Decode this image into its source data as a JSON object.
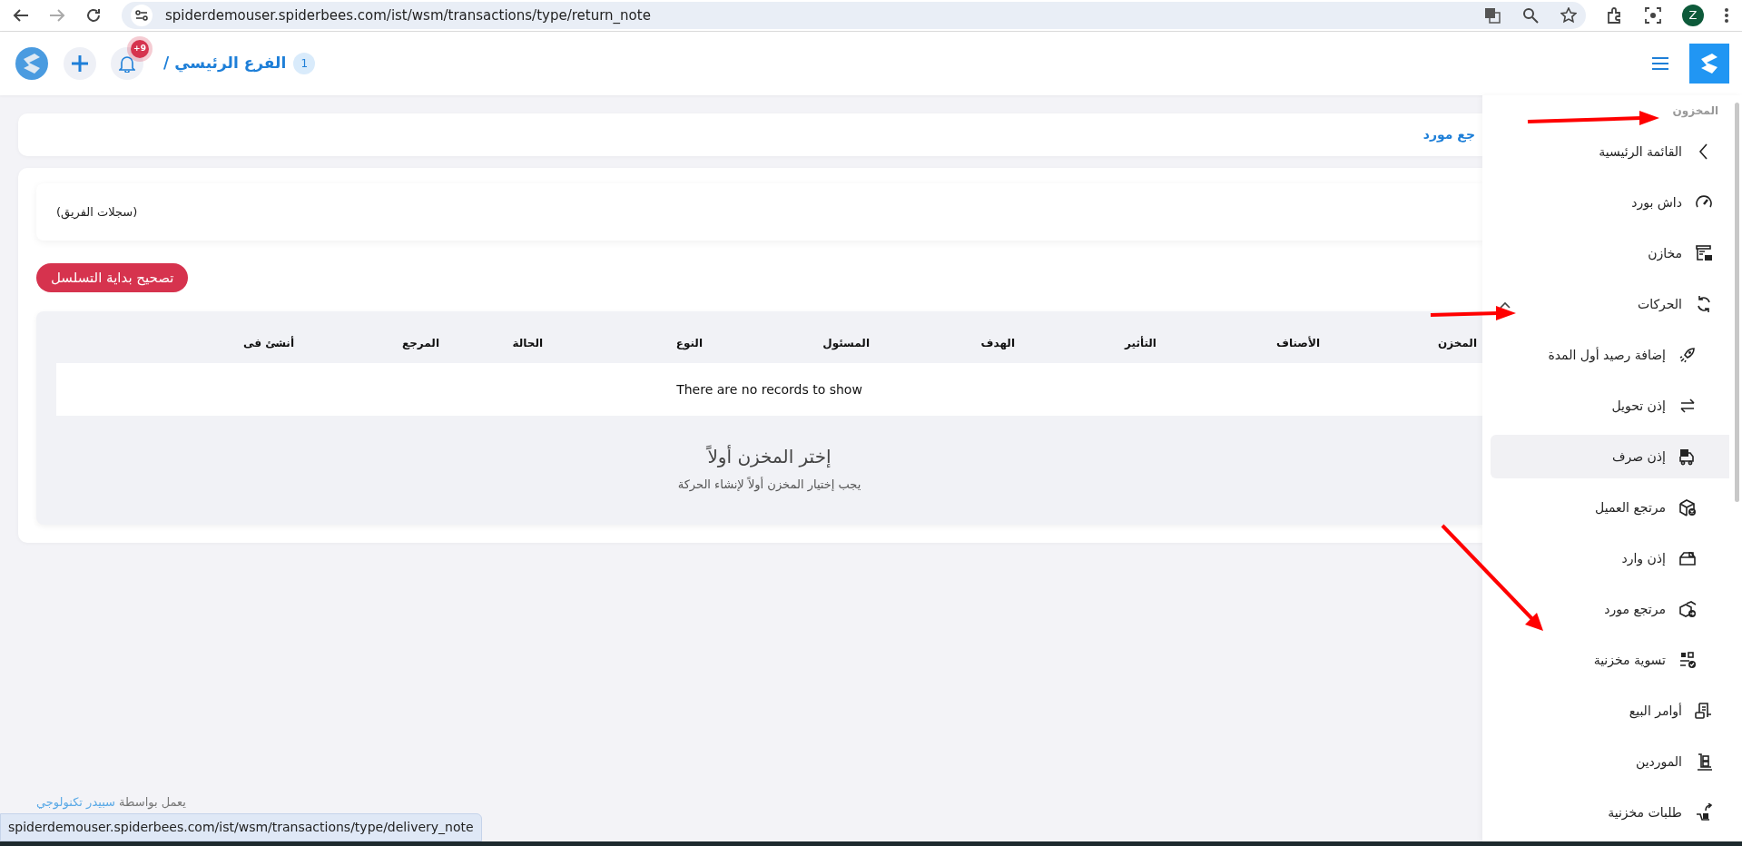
{
  "browser": {
    "url": "spiderdemouser.spiderbees.com/ist/wsm/transactions/type/return_note",
    "profile": "Z"
  },
  "header": {
    "branch_label": "الفرع الرئيسي /",
    "branch_badge": "1",
    "notification_count": "+9"
  },
  "page_title": "جع مورد",
  "team_records": "(سجلات الفريق)",
  "reset_button": "تصحيح بداية التسلسل",
  "table": {
    "columns": [
      "المخزن",
      "الأصناف",
      "التأثير",
      "الهدف",
      "المسئول",
      "النوع",
      "الحالة",
      "المرجع",
      "أنشئ فى"
    ],
    "empty_message": "There are no records to show"
  },
  "empty_state": {
    "title": "إختر المخزن أولاً",
    "subtitle": "يجب إختيار المخزن أولاً لإنشاء الحركة"
  },
  "sidebar": {
    "section_title": "المخزون",
    "items": [
      {
        "label": "القائمة الرئيسية",
        "kind": "back",
        "selected": false
      },
      {
        "label": "داش بورد",
        "kind": "item",
        "selected": false
      },
      {
        "label": "مخازن",
        "kind": "item",
        "selected": false
      },
      {
        "label": "الحركات",
        "kind": "group",
        "selected": false,
        "expanded": true,
        "children": [
          {
            "label": "إضافة رصيد أول المدة",
            "selected": false
          },
          {
            "label": "إذن تحويل",
            "selected": false
          },
          {
            "label": "إذن صرف",
            "selected": true
          },
          {
            "label": "مرتجع العميل",
            "selected": false
          },
          {
            "label": "إذن وارد",
            "selected": false
          },
          {
            "label": "مرتجع مورد",
            "selected": false
          },
          {
            "label": "تسوية مخزنية",
            "selected": false
          }
        ]
      },
      {
        "label": "أوامر البيع",
        "kind": "item",
        "selected": false
      },
      {
        "label": "الموردين",
        "kind": "item",
        "selected": false
      },
      {
        "label": "طلبات مخزنية",
        "kind": "item",
        "selected": false
      }
    ]
  },
  "footer": {
    "text": "يعمل بواسطة",
    "link": "سبيدر تكنولوجي"
  },
  "status_url": "spiderdemouser.spiderbees.com/ist/wsm/transactions/type/delivery_note"
}
